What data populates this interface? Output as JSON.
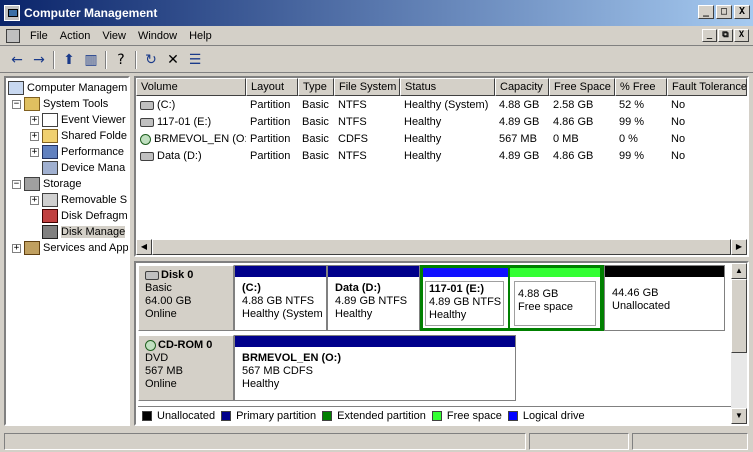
{
  "window": {
    "title": "Computer Management",
    "min": "_",
    "max": "□",
    "close": "X"
  },
  "menubar": {
    "items": [
      "File",
      "Action",
      "View",
      "Window",
      "Help"
    ],
    "mdi_min": "_",
    "mdi_restore": "⧉",
    "mdi_close": "X"
  },
  "toolbar": {
    "back": "←",
    "forward": "→",
    "up": "⬆",
    "show_hide": "▥",
    "help": "?",
    "refresh": "↻",
    "delete": "✕",
    "properties": "☰"
  },
  "tree": {
    "root": "Computer Managem",
    "system_tools": "System Tools",
    "event_viewer": "Event Viewer",
    "shared_folders": "Shared Folde",
    "performance": "Performance",
    "device_manager": "Device Mana",
    "storage": "Storage",
    "removable": "Removable S",
    "defrag": "Disk Defragm",
    "disk_management": "Disk Manage",
    "services": "Services and App"
  },
  "volumes": {
    "columns": [
      "Volume",
      "Layout",
      "Type",
      "File System",
      "Status",
      "Capacity",
      "Free Space",
      "% Free",
      "Fault Tolerance"
    ],
    "rows": [
      {
        "volume": "(C:)",
        "layout": "Partition",
        "type": "Basic",
        "fs": "NTFS",
        "status": "Healthy (System)",
        "capacity": "4.88 GB",
        "free": "2.58 GB",
        "pct": "52 %",
        "fault": "No",
        "icon": "disk"
      },
      {
        "volume": "117-01 (E:)",
        "layout": "Partition",
        "type": "Basic",
        "fs": "NTFS",
        "status": "Healthy",
        "capacity": "4.89 GB",
        "free": "4.86 GB",
        "pct": "99 %",
        "fault": "No",
        "icon": "disk"
      },
      {
        "volume": "BRMEVOL_EN (O:)",
        "layout": "Partition",
        "type": "Basic",
        "fs": "CDFS",
        "status": "Healthy",
        "capacity": "567 MB",
        "free": "0 MB",
        "pct": "0 %",
        "fault": "No",
        "icon": "cdrom"
      },
      {
        "volume": "Data (D:)",
        "layout": "Partition",
        "type": "Basic",
        "fs": "NTFS",
        "status": "Healthy",
        "capacity": "4.89 GB",
        "free": "4.86 GB",
        "pct": "99 %",
        "fault": "No",
        "icon": "disk"
      }
    ]
  },
  "disks": {
    "disk0": {
      "name": "Disk 0",
      "type": "Basic",
      "size": "64.00 GB",
      "state": "Online"
    },
    "cdrom0": {
      "name": "CD-ROM 0",
      "type": "DVD",
      "size": "567 MB",
      "state": "Online"
    }
  },
  "partitions": {
    "c": {
      "name": "(C:)",
      "size": "4.88 GB NTFS",
      "status": "Healthy (System"
    },
    "d": {
      "name": "Data  (D:)",
      "size": "4.89 GB NTFS",
      "status": "Healthy"
    },
    "e": {
      "name": "117-01  (E:)",
      "size": "4.89 GB NTFS",
      "status": "Healthy"
    },
    "free": {
      "size": "4.88 GB",
      "status": "Free space"
    },
    "unalloc": {
      "size": "44.46 GB",
      "status": "Unallocated"
    },
    "o": {
      "name": "BRMEVOL_EN  (O:)",
      "size": "567 MB CDFS",
      "status": "Healthy"
    }
  },
  "legend": [
    {
      "label": "Unallocated",
      "color": "#000000"
    },
    {
      "label": "Primary partition",
      "color": "#00008b"
    },
    {
      "label": "Extended partition",
      "color": "#008000"
    },
    {
      "label": "Free space",
      "color": "#33ff33"
    },
    {
      "label": "Logical drive",
      "color": "#0000ff"
    }
  ],
  "colors": {
    "primary": "#00008b",
    "logical": "#1010ff",
    "free": "#33ff33",
    "unallocated": "#000000",
    "extended": "#008000"
  }
}
